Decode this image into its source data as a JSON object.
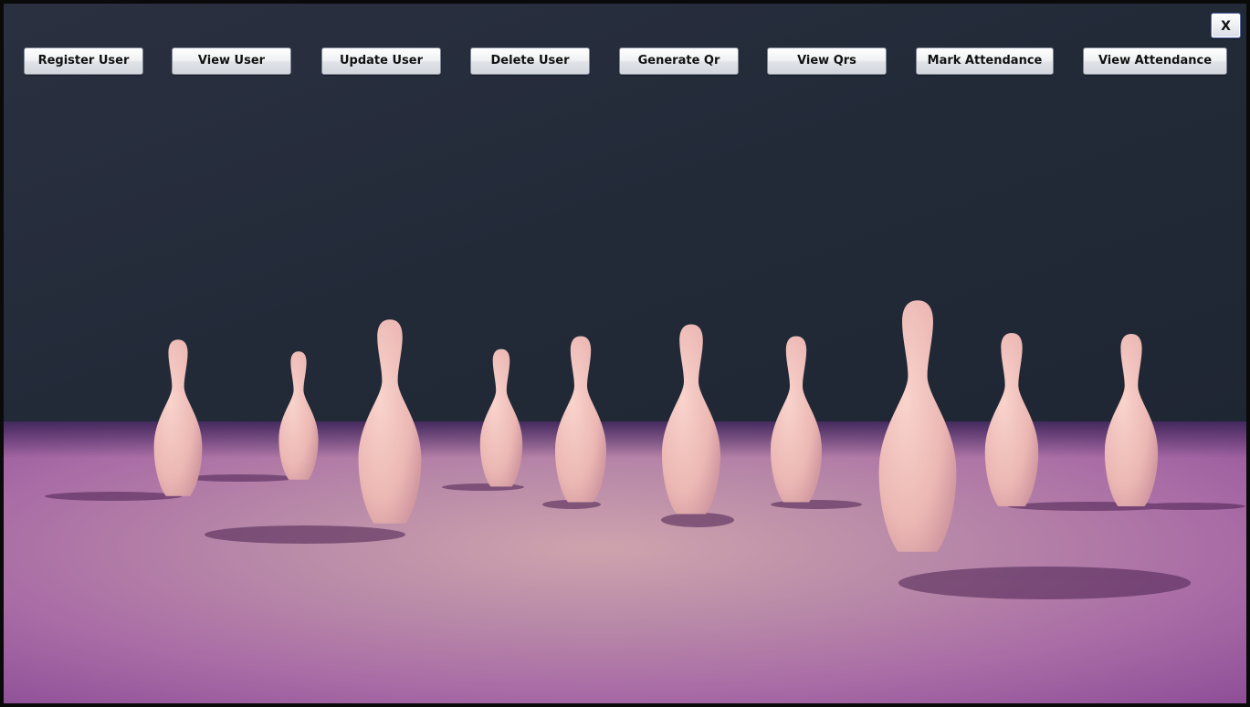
{
  "window": {
    "close_label": "X"
  },
  "toolbar": {
    "buttons": [
      {
        "id": "register-user",
        "label": "Register User"
      },
      {
        "id": "view-user",
        "label": "View User"
      },
      {
        "id": "update-user",
        "label": "Update User"
      },
      {
        "id": "delete-user",
        "label": "Delete User"
      },
      {
        "id": "generate-qr",
        "label": "Generate Qr"
      },
      {
        "id": "view-qrs",
        "label": "View Qrs"
      },
      {
        "id": "mark-attendance",
        "label": "Mark Attendance"
      },
      {
        "id": "view-attendance",
        "label": "View Attendance"
      }
    ]
  },
  "background": {
    "description_icon": "bowling-pins-scene",
    "wall_color": "#222a38",
    "floor_color": "#b678b0",
    "pin_color": "#f0bfb8",
    "pin_count": 10
  }
}
